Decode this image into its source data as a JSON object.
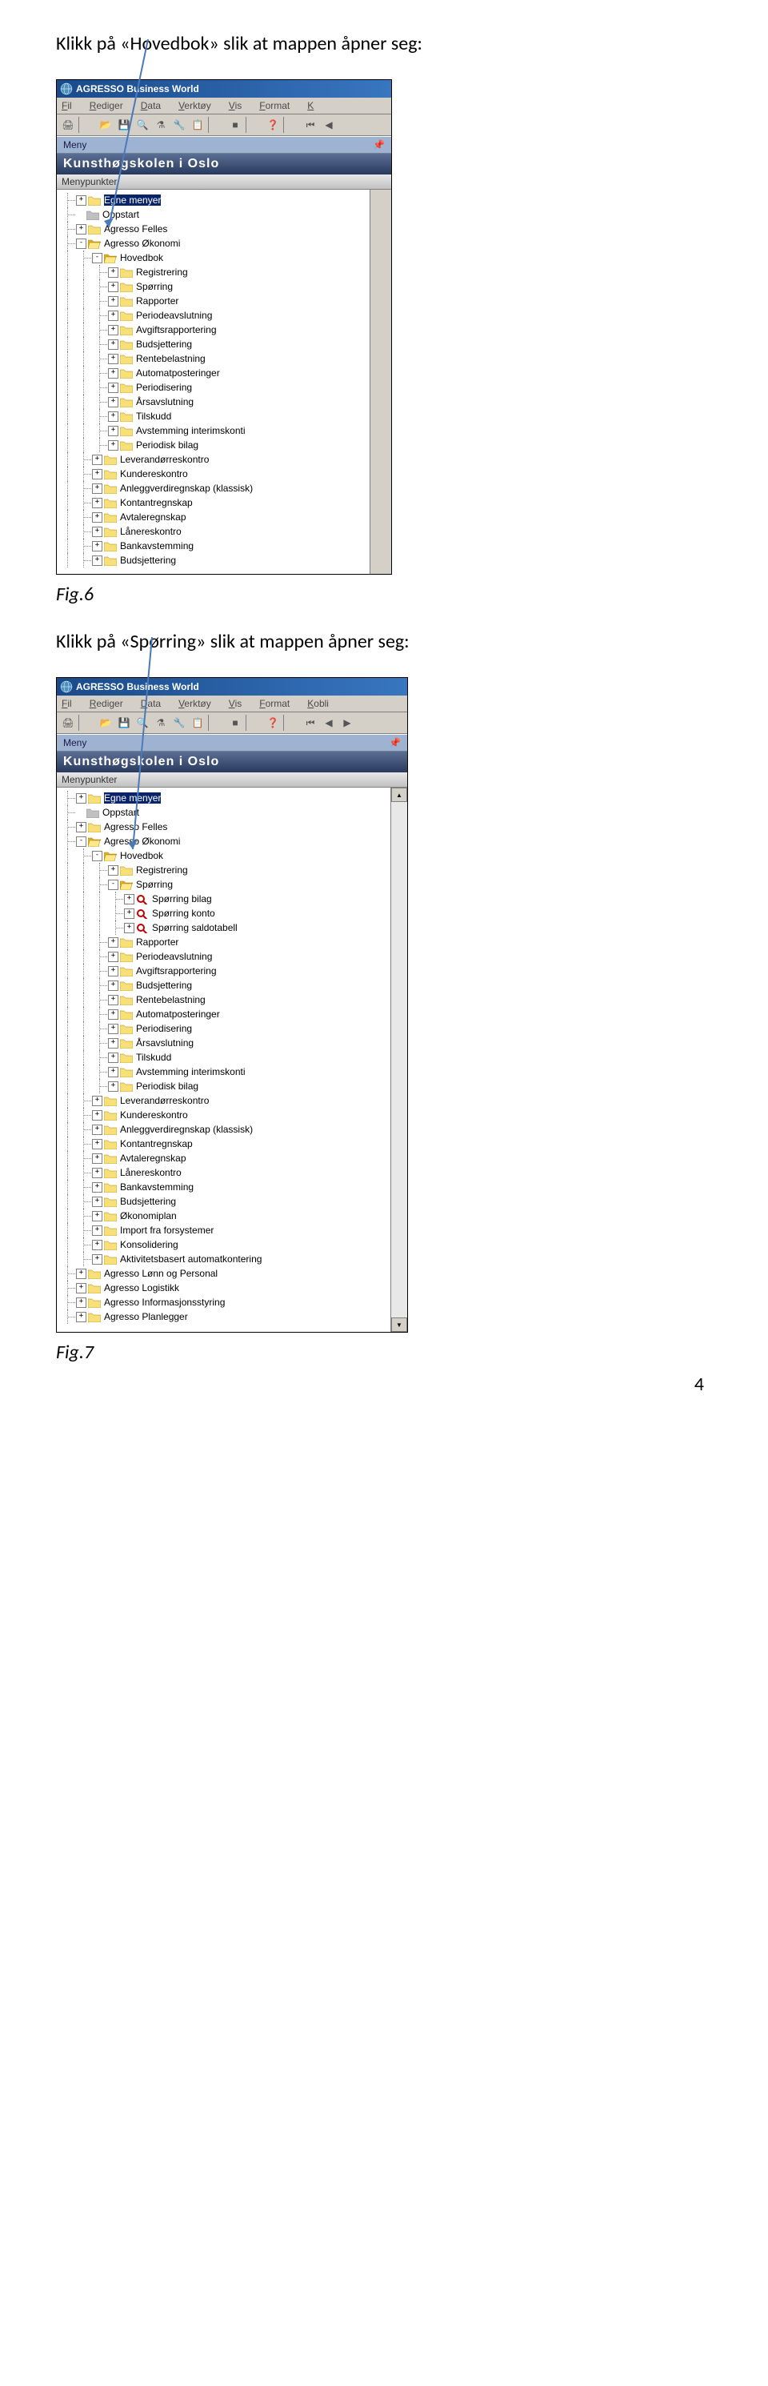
{
  "instruction_1": "Klikk på «Hovedbok» slik at mappen åpner seg:",
  "instruction_2": "Klikk på «Spørring» slik at mappen åpner seg:",
  "fig_6": "Fig.6",
  "fig_7": "Fig.7",
  "page_number": "4",
  "app": {
    "title": "AGRESSO Business World",
    "menubar": [
      "Fil",
      "Rediger",
      "Data",
      "Verktøy",
      "Vis",
      "Format",
      "K"
    ],
    "menubar2": [
      "Fil",
      "Rediger",
      "Data",
      "Verktøy",
      "Vis",
      "Format",
      "Kobli"
    ],
    "meny_label": "Meny",
    "org_title": "Kunsthøgskolen i Oslo",
    "menypunkter": "Menypunkter"
  },
  "tree1": [
    {
      "depth": 0,
      "exp": "+",
      "icon": "folder-closed",
      "label": "Egne menyer",
      "sel": true
    },
    {
      "depth": 0,
      "exp": "",
      "icon": "folder-gray",
      "label": "Oppstart"
    },
    {
      "depth": 0,
      "exp": "+",
      "icon": "folder-closed",
      "label": "Agresso Felles"
    },
    {
      "depth": 0,
      "exp": "-",
      "icon": "folder-open",
      "label": "Agresso Økonomi"
    },
    {
      "depth": 1,
      "exp": "-",
      "icon": "folder-open",
      "label": "Hovedbok"
    },
    {
      "depth": 2,
      "exp": "+",
      "icon": "folder-closed",
      "label": "Registrering"
    },
    {
      "depth": 2,
      "exp": "+",
      "icon": "folder-closed",
      "label": "Spørring"
    },
    {
      "depth": 2,
      "exp": "+",
      "icon": "folder-closed",
      "label": "Rapporter"
    },
    {
      "depth": 2,
      "exp": "+",
      "icon": "folder-closed",
      "label": "Periodeavslutning"
    },
    {
      "depth": 2,
      "exp": "+",
      "icon": "folder-closed",
      "label": "Avgiftsrapportering"
    },
    {
      "depth": 2,
      "exp": "+",
      "icon": "folder-closed",
      "label": "Budsjettering"
    },
    {
      "depth": 2,
      "exp": "+",
      "icon": "folder-closed",
      "label": "Rentebelastning"
    },
    {
      "depth": 2,
      "exp": "+",
      "icon": "folder-closed",
      "label": "Automatposteringer"
    },
    {
      "depth": 2,
      "exp": "+",
      "icon": "folder-closed",
      "label": "Periodisering"
    },
    {
      "depth": 2,
      "exp": "+",
      "icon": "folder-closed",
      "label": "Årsavslutning"
    },
    {
      "depth": 2,
      "exp": "+",
      "icon": "folder-closed",
      "label": "Tilskudd"
    },
    {
      "depth": 2,
      "exp": "+",
      "icon": "folder-closed",
      "label": "Avstemming interimskonti"
    },
    {
      "depth": 2,
      "exp": "+",
      "icon": "folder-closed",
      "label": "Periodisk bilag"
    },
    {
      "depth": 1,
      "exp": "+",
      "icon": "folder-closed",
      "label": "Leverandørreskontro"
    },
    {
      "depth": 1,
      "exp": "+",
      "icon": "folder-closed",
      "label": "Kundereskontro"
    },
    {
      "depth": 1,
      "exp": "+",
      "icon": "folder-closed",
      "label": "Anleggverdiregnskap (klassisk)"
    },
    {
      "depth": 1,
      "exp": "+",
      "icon": "folder-closed",
      "label": "Kontantregnskap"
    },
    {
      "depth": 1,
      "exp": "+",
      "icon": "folder-closed",
      "label": "Avtaleregnskap"
    },
    {
      "depth": 1,
      "exp": "+",
      "icon": "folder-closed",
      "label": "Lånereskontro"
    },
    {
      "depth": 1,
      "exp": "+",
      "icon": "folder-closed",
      "label": "Bankavstemming"
    },
    {
      "depth": 1,
      "exp": "+",
      "icon": "folder-closed",
      "label": "Budsjettering"
    }
  ],
  "tree2": [
    {
      "depth": 0,
      "exp": "+",
      "icon": "folder-closed",
      "label": "Egne menyer",
      "sel": true
    },
    {
      "depth": 0,
      "exp": "",
      "icon": "folder-gray",
      "label": "Oppstart"
    },
    {
      "depth": 0,
      "exp": "+",
      "icon": "folder-closed",
      "label": "Agresso Felles"
    },
    {
      "depth": 0,
      "exp": "-",
      "icon": "folder-open",
      "label": "Agresso Økonomi"
    },
    {
      "depth": 1,
      "exp": "-",
      "icon": "folder-open",
      "label": "Hovedbok"
    },
    {
      "depth": 2,
      "exp": "+",
      "icon": "folder-closed",
      "label": "Registrering"
    },
    {
      "depth": 2,
      "exp": "-",
      "icon": "folder-open",
      "label": "Spørring"
    },
    {
      "depth": 3,
      "exp": "+",
      "icon": "mag",
      "label": "Spørring bilag"
    },
    {
      "depth": 3,
      "exp": "+",
      "icon": "mag",
      "label": "Spørring konto"
    },
    {
      "depth": 3,
      "exp": "+",
      "icon": "mag",
      "label": "Spørring saldotabell"
    },
    {
      "depth": 2,
      "exp": "+",
      "icon": "folder-closed",
      "label": "Rapporter"
    },
    {
      "depth": 2,
      "exp": "+",
      "icon": "folder-closed",
      "label": "Periodeavslutning"
    },
    {
      "depth": 2,
      "exp": "+",
      "icon": "folder-closed",
      "label": "Avgiftsrapportering"
    },
    {
      "depth": 2,
      "exp": "+",
      "icon": "folder-closed",
      "label": "Budsjettering"
    },
    {
      "depth": 2,
      "exp": "+",
      "icon": "folder-closed",
      "label": "Rentebelastning"
    },
    {
      "depth": 2,
      "exp": "+",
      "icon": "folder-closed",
      "label": "Automatposteringer"
    },
    {
      "depth": 2,
      "exp": "+",
      "icon": "folder-closed",
      "label": "Periodisering"
    },
    {
      "depth": 2,
      "exp": "+",
      "icon": "folder-closed",
      "label": "Årsavslutning"
    },
    {
      "depth": 2,
      "exp": "+",
      "icon": "folder-closed",
      "label": "Tilskudd"
    },
    {
      "depth": 2,
      "exp": "+",
      "icon": "folder-closed",
      "label": "Avstemming interimskonti"
    },
    {
      "depth": 2,
      "exp": "+",
      "icon": "folder-closed",
      "label": "Periodisk bilag"
    },
    {
      "depth": 1,
      "exp": "+",
      "icon": "folder-closed",
      "label": "Leverandørreskontro"
    },
    {
      "depth": 1,
      "exp": "+",
      "icon": "folder-closed",
      "label": "Kundereskontro"
    },
    {
      "depth": 1,
      "exp": "+",
      "icon": "folder-closed",
      "label": "Anleggverdiregnskap (klassisk)"
    },
    {
      "depth": 1,
      "exp": "+",
      "icon": "folder-closed",
      "label": "Kontantregnskap"
    },
    {
      "depth": 1,
      "exp": "+",
      "icon": "folder-closed",
      "label": "Avtaleregnskap"
    },
    {
      "depth": 1,
      "exp": "+",
      "icon": "folder-closed",
      "label": "Lånereskontro"
    },
    {
      "depth": 1,
      "exp": "+",
      "icon": "folder-closed",
      "label": "Bankavstemming"
    },
    {
      "depth": 1,
      "exp": "+",
      "icon": "folder-closed",
      "label": "Budsjettering"
    },
    {
      "depth": 1,
      "exp": "+",
      "icon": "folder-closed",
      "label": "Økonomiplan"
    },
    {
      "depth": 1,
      "exp": "+",
      "icon": "folder-closed",
      "label": "Import fra forsystemer"
    },
    {
      "depth": 1,
      "exp": "+",
      "icon": "folder-closed",
      "label": "Konsolidering"
    },
    {
      "depth": 1,
      "exp": "+",
      "icon": "folder-closed",
      "label": "Aktivitetsbasert automatkontering"
    },
    {
      "depth": 0,
      "exp": "+",
      "icon": "folder-closed",
      "label": "Agresso Lønn og Personal"
    },
    {
      "depth": 0,
      "exp": "+",
      "icon": "folder-closed",
      "label": "Agresso Logistikk"
    },
    {
      "depth": 0,
      "exp": "+",
      "icon": "folder-closed",
      "label": "Agresso Informasjonsstyring"
    },
    {
      "depth": 0,
      "exp": "+",
      "icon": "folder-closed",
      "label": "Agresso Planlegger"
    }
  ]
}
